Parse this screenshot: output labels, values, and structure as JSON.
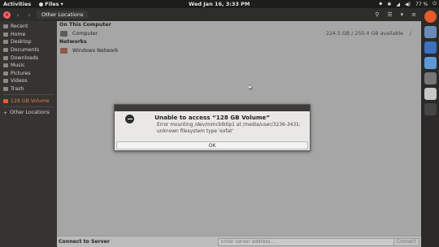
{
  "top_panel": {
    "activities": "Activities",
    "app_name": "Files",
    "clock": "Wed Jan 16,  3:33 PM",
    "battery": "77 %"
  },
  "headerbar": {
    "location": "Other Locations"
  },
  "sidebar": {
    "items": [
      {
        "label": "Recent",
        "icon": "clock-icon"
      },
      {
        "label": "Home",
        "icon": "home-icon"
      },
      {
        "label": "Desktop",
        "icon": "desktop-icon"
      },
      {
        "label": "Documents",
        "icon": "documents-icon"
      },
      {
        "label": "Downloads",
        "icon": "downloads-icon"
      },
      {
        "label": "Music",
        "icon": "music-icon"
      },
      {
        "label": "Pictures",
        "icon": "pictures-icon"
      },
      {
        "label": "Videos",
        "icon": "videos-icon"
      },
      {
        "label": "Trash",
        "icon": "trash-icon"
      }
    ],
    "volume": "128 GB Volume",
    "other_locations": "Other Locations"
  },
  "main": {
    "on_this_computer": "On This Computer",
    "computer": {
      "label": "Computer",
      "size": "224.5 GB / 250.4 GB available",
      "action": "/"
    },
    "networks": "Networks",
    "windows_network": "Windows Network"
  },
  "dialog": {
    "title": "Unable to access “128 GB Volume”",
    "message": "Error mounting /dev/mmcblk0p1 at /media/user/3236-3431: unknown filesystem type 'exfat'",
    "ok_label": "OK"
  },
  "bottom_bar": {
    "connect_to_server": "Connect to Server",
    "server_placeholder": "Enter server address…",
    "connect_label": "Connect"
  },
  "colors": {
    "eject_accent": "#e8794a",
    "close_button": "#f46067"
  }
}
